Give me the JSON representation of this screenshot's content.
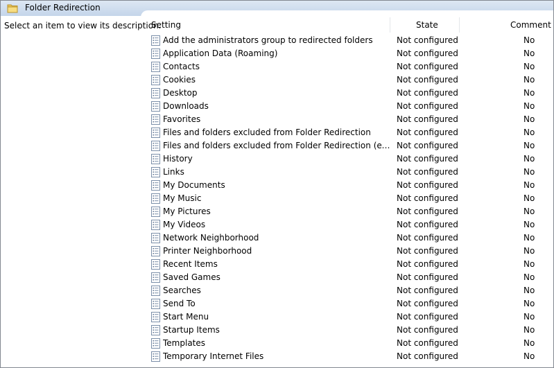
{
  "header": {
    "title": "Folder Redirection"
  },
  "description_text": "Select an item to view its description.",
  "columns": {
    "setting": "Setting",
    "state": "State",
    "comment": "Comment"
  },
  "rows": [
    {
      "setting": "Add the administrators group to redirected folders",
      "state": "Not configured",
      "comment": "No"
    },
    {
      "setting": "Application Data (Roaming)",
      "state": "Not configured",
      "comment": "No"
    },
    {
      "setting": "Contacts",
      "state": "Not configured",
      "comment": "No"
    },
    {
      "setting": "Cookies",
      "state": "Not configured",
      "comment": "No"
    },
    {
      "setting": "Desktop",
      "state": "Not configured",
      "comment": "No"
    },
    {
      "setting": "Downloads",
      "state": "Not configured",
      "comment": "No"
    },
    {
      "setting": "Favorites",
      "state": "Not configured",
      "comment": "No"
    },
    {
      "setting": "Files and folders excluded from Folder Redirection",
      "state": "Not configured",
      "comment": "No"
    },
    {
      "setting": "Files and folders excluded from Folder Redirection (exceptions)",
      "state": "Not configured",
      "comment": "No"
    },
    {
      "setting": "History",
      "state": "Not configured",
      "comment": "No"
    },
    {
      "setting": "Links",
      "state": "Not configured",
      "comment": "No"
    },
    {
      "setting": "My Documents",
      "state": "Not configured",
      "comment": "No"
    },
    {
      "setting": "My Music",
      "state": "Not configured",
      "comment": "No"
    },
    {
      "setting": "My Pictures",
      "state": "Not configured",
      "comment": "No"
    },
    {
      "setting": "My Videos",
      "state": "Not configured",
      "comment": "No"
    },
    {
      "setting": "Network Neighborhood",
      "state": "Not configured",
      "comment": "No"
    },
    {
      "setting": "Printer Neighborhood",
      "state": "Not configured",
      "comment": "No"
    },
    {
      "setting": "Recent Items",
      "state": "Not configured",
      "comment": "No"
    },
    {
      "setting": "Saved Games",
      "state": "Not configured",
      "comment": "No"
    },
    {
      "setting": "Searches",
      "state": "Not configured",
      "comment": "No"
    },
    {
      "setting": "Send To",
      "state": "Not configured",
      "comment": "No"
    },
    {
      "setting": "Start Menu",
      "state": "Not configured",
      "comment": "No"
    },
    {
      "setting": "Startup Items",
      "state": "Not configured",
      "comment": "No"
    },
    {
      "setting": "Templates",
      "state": "Not configured",
      "comment": "No"
    },
    {
      "setting": "Temporary Internet Files",
      "state": "Not configured",
      "comment": "No"
    }
  ],
  "icons": {
    "header": "folder-icon",
    "row": "policy-setting-icon"
  },
  "colors": {
    "header_bar": "#c4d5ea",
    "window_border": "#828790"
  }
}
